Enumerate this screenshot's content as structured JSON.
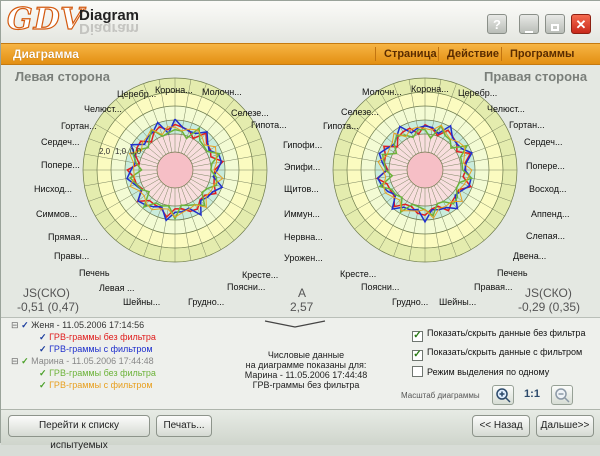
{
  "app": {
    "logo_text": "GDV",
    "logo_word": "Diagram"
  },
  "titlebar_buttons": {
    "help": "?",
    "close": "✕"
  },
  "menubar": {
    "section_title": "Диаграмма",
    "items": [
      "Страница",
      "Действие",
      "Программы"
    ]
  },
  "left_side": {
    "title": "Левая сторона",
    "labels": {
      "l00": "Корона...",
      "l01": "Молочн...",
      "l02": "Селезе...",
      "l03": "Гипота...",
      "l04": "Гипофи...",
      "l05": "Эпифи...",
      "l06": "Щитов...",
      "l07": "Иммун...",
      "l08": "Нервна...",
      "l09": "Урожен...",
      "l10": "Кресте...",
      "l11": "Поясни...",
      "l12": "Грудно...",
      "l13": "Шейны...",
      "l14": "Левая ...",
      "l15": "Печень",
      "l16": "Правы...",
      "l17": "Прямая...",
      "l18": "Симмов...",
      "l19": "Нисход...",
      "l20": "Попере...",
      "l21": "Сердеч...",
      "l22": "Гортан...",
      "l23": "Челюст...",
      "l24": "Церебр..."
    },
    "stat_label": "JS(СКО)",
    "stat_value": "-0,51 (0,47)"
  },
  "right_side": {
    "title": "Правая сторона",
    "labels": {
      "r00": "Молочн...",
      "r01": "Корона...",
      "r02": "Церебр...",
      "r03": "Челюст...",
      "r04": "Гортан...",
      "r05": "Сердеч...",
      "r06": "Попере...",
      "r07": "Восход...",
      "r08": "Аппенд...",
      "r09": "Слепая...",
      "r10": "Двена...",
      "r11": "Печень",
      "r12": "Правая...",
      "r13": "Шейны...",
      "r14": "Грудно...",
      "r15": "Поясни...",
      "r16": "Кресте...",
      "r17": "Гипота...",
      "r18": "Селезе..."
    },
    "stat_label": "JS(СКО)",
    "stat_value": "-0,29 (0,35)"
  },
  "scale_labels": [
    "2,0",
    "1,0",
    "0,0"
  ],
  "center_stat": {
    "label": "A",
    "value": "2,57"
  },
  "tree": {
    "group1": {
      "name": "Женя - 11.05.2006 17:14:56",
      "item1": "ГРВ-граммы без фильтра",
      "item2": "ГРВ-граммы с фильтром"
    },
    "group2": {
      "name": "Марина - 11.05.2006 17:44:48",
      "item1": "ГРВ-граммы без фильтра",
      "item2": "ГРВ-граммы с фильтром"
    }
  },
  "note": {
    "line1": "Числовые данные",
    "line2": "на диаграмме показаны для:",
    "line3": "Марина - 11.05.2006 17:44:48",
    "line4": "ГРВ-граммы без фильтра"
  },
  "options": {
    "show_unfiltered": "Показать/скрыть данные без фильтра",
    "show_filtered": "Показать/скрыть данные с фильтром",
    "select_one": "Режим выделения по одному",
    "scale_label": "Масштаб диаграммы",
    "zoom_reset": "1:1"
  },
  "footer": {
    "list_button": "Перейти к списку испытуемых",
    "print_button": "Печать...",
    "back_button": "<< Назад",
    "next_button": "Дальше>>"
  },
  "colors": {
    "accent_orange": "#e8951a",
    "series_red": "#e02020",
    "series_blue": "#1f2fcc",
    "series_green": "#6db33a",
    "series_orange": "#e8a020"
  }
}
